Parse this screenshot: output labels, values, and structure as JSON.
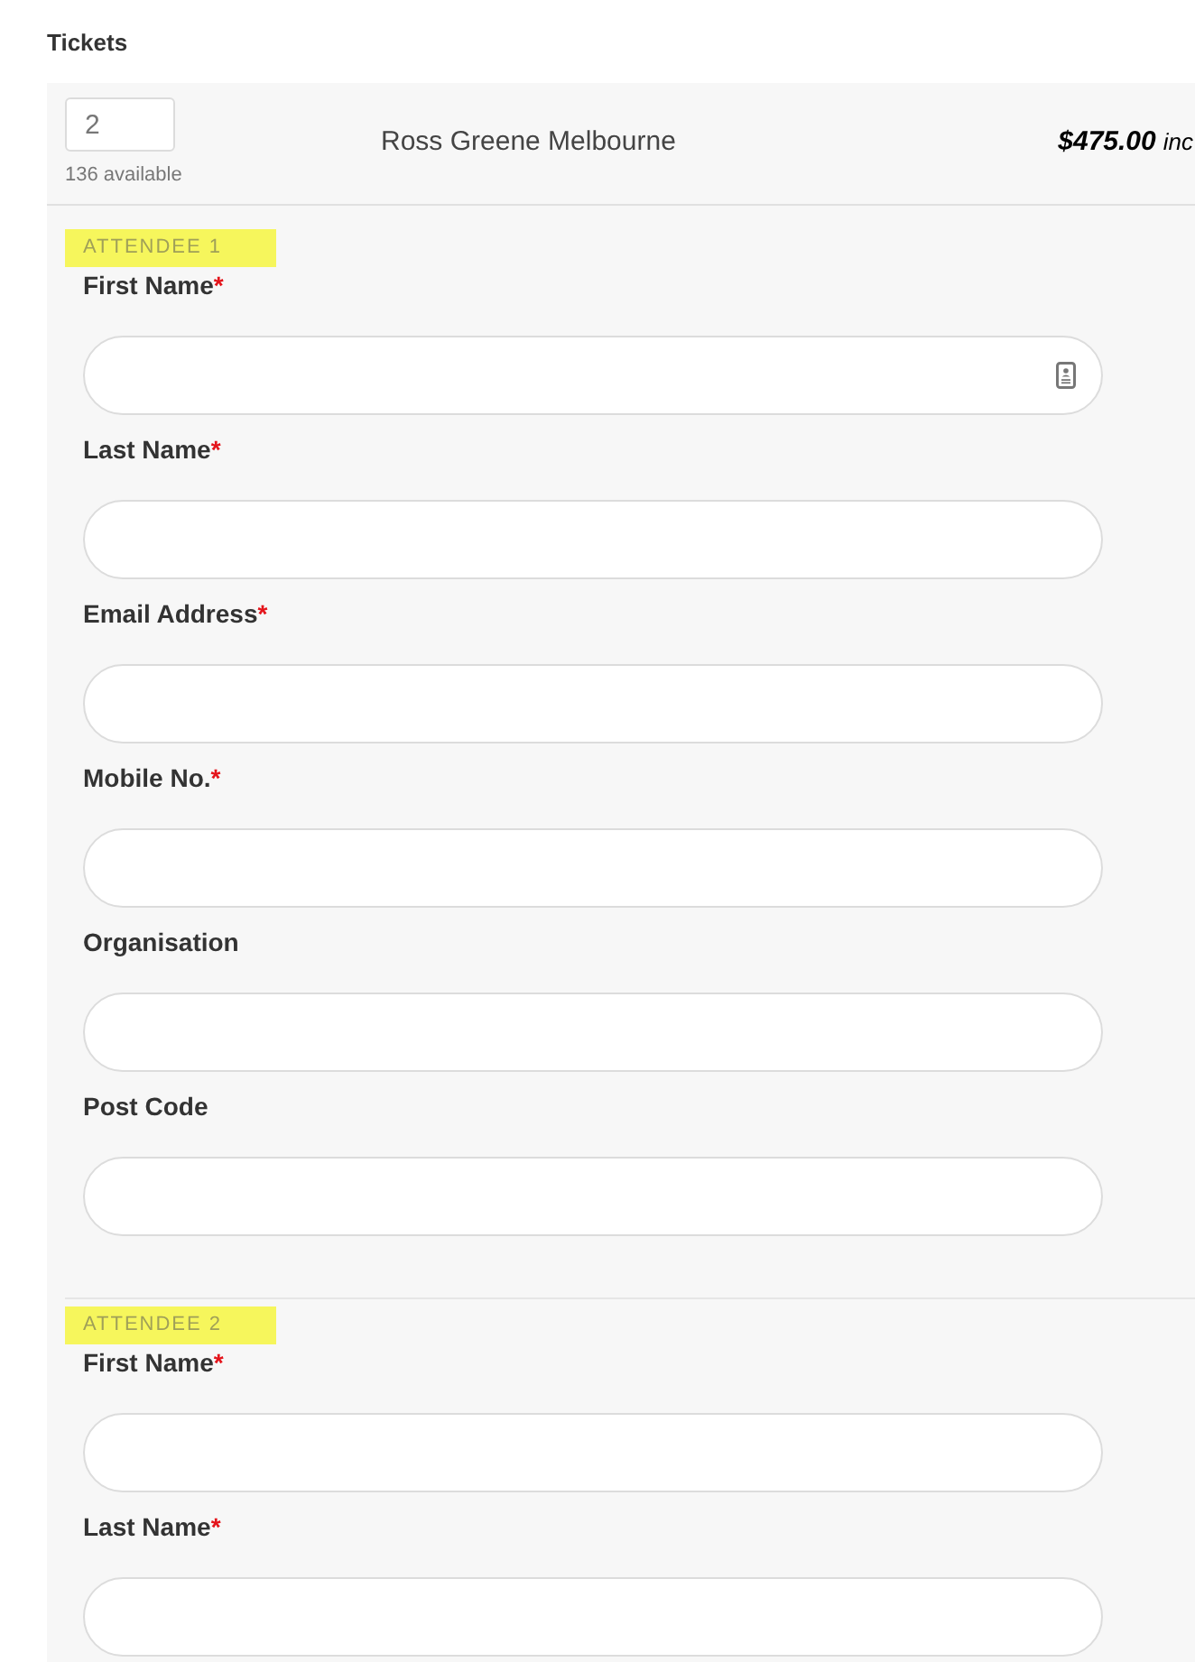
{
  "section_title": "Tickets",
  "ticket": {
    "quantity": "2",
    "availability": "136 available",
    "name": "Ross Greene Melbourne",
    "price": "$475.00",
    "price_note": "inc"
  },
  "attendees": [
    {
      "heading": "ATTENDEE 1",
      "highlighted": true,
      "fields": [
        {
          "label": "First Name",
          "required_mark": "*",
          "contact_icon": true
        },
        {
          "label": "Last Name",
          "required_mark": "*"
        },
        {
          "label": "Email Address",
          "required_mark": "*"
        },
        {
          "label": "Mobile No.",
          "required_mark": "*"
        },
        {
          "label": "Organisation"
        },
        {
          "label": "Post Code"
        }
      ]
    },
    {
      "heading": "ATTENDEE 2",
      "highlighted": true,
      "fields": [
        {
          "label": "First Name",
          "required_mark": "*"
        },
        {
          "label": "Last Name",
          "required_mark": "*"
        }
      ]
    }
  ]
}
